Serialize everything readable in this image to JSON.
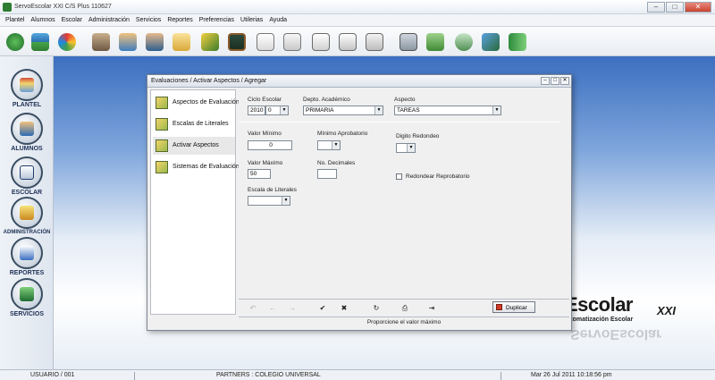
{
  "window": {
    "title": "ServoEscolar XXI C/S Plus 110627",
    "minimize": "–",
    "maximize": "□",
    "close": "✕"
  },
  "menu": [
    "Plantel",
    "Alumnos",
    "Escolar",
    "Administración",
    "Servicios",
    "Reportes",
    "Preferencias",
    "Utilerias",
    "Ayuda"
  ],
  "toolbar_icons": [
    "refresh-icon",
    "coins-icon",
    "palette-icon",
    "users-icon",
    "group-icon",
    "teacher-icon",
    "folder-icon",
    "pen-user-icon",
    "blackboard-icon",
    "checklist-icon",
    "document-icon",
    "grades-icon",
    "pages-icon",
    "copy-icon",
    "calculator-icon",
    "money-icon",
    "payment-icon",
    "scan-icon",
    "exit-door-icon"
  ],
  "sidebar": {
    "items": [
      {
        "label": "PLANTEL",
        "icon": "plantel-icon"
      },
      {
        "label": "ALUMNOS",
        "icon": "alumnos-icon"
      },
      {
        "label": "ESCOLAR",
        "icon": "escolar-icon"
      },
      {
        "label": "ADMINISTRACIÓN",
        "icon": "administracion-icon"
      },
      {
        "label": "REPORTES",
        "icon": "reportes-icon"
      },
      {
        "label": "SERVICIOS",
        "icon": "servicios-icon"
      }
    ]
  },
  "brand": {
    "name": "Escolar",
    "suffix": "XXI",
    "subtitle": "utomatización Escolar",
    "reflection": "ServoEscolar"
  },
  "dialog": {
    "title": "Evaluaciones / Activar Aspectos / Agregar",
    "nav": [
      {
        "label": "Aspectos de Evaluación",
        "active": false
      },
      {
        "label": "Escalas de Literales",
        "active": false
      },
      {
        "label": "Activar Aspectos",
        "active": true
      },
      {
        "label": "Sistemas de Evaluación",
        "active": false
      }
    ],
    "fields": {
      "ciclo_label": "Ciclo Escolar",
      "ciclo_year": "2010",
      "ciclo_num": "0",
      "depto_label": "Depto. Académico",
      "depto_value": "PRIMARIA",
      "aspecto_label": "Aspecto",
      "aspecto_value": "TAREAS",
      "valor_min_label": "Valor Mínimo",
      "valor_min_value": "0",
      "min_aprob_label": "Mínimo Aprobatorio",
      "min_aprob_value": "",
      "digito_label": "Digito Redondeo",
      "digito_value": "",
      "valor_max_label": "Valor Máximo",
      "valor_max_value": "50",
      "no_decimales_label": "No. Decimales",
      "no_decimales_value": "",
      "redondear_label": "Redondear Reprobatorio",
      "escala_label": "Escala de Literales",
      "escala_value": ""
    },
    "toolbar": {
      "first": "↶",
      "prev": "←",
      "next": "→",
      "accept": "✔",
      "cancel": "✖",
      "refresh": "↻",
      "print": "⎙",
      "exit": "⇥",
      "duplicate_label": "Duplicar"
    },
    "status": "Proporcione el valor máximo"
  },
  "statusbar": {
    "user": "USUARIO / 001",
    "school": "PARTNERS : COLEGIO UNIVERSAL",
    "datetime": "Mar 26 Jul 2011  10:18:56 pm"
  }
}
